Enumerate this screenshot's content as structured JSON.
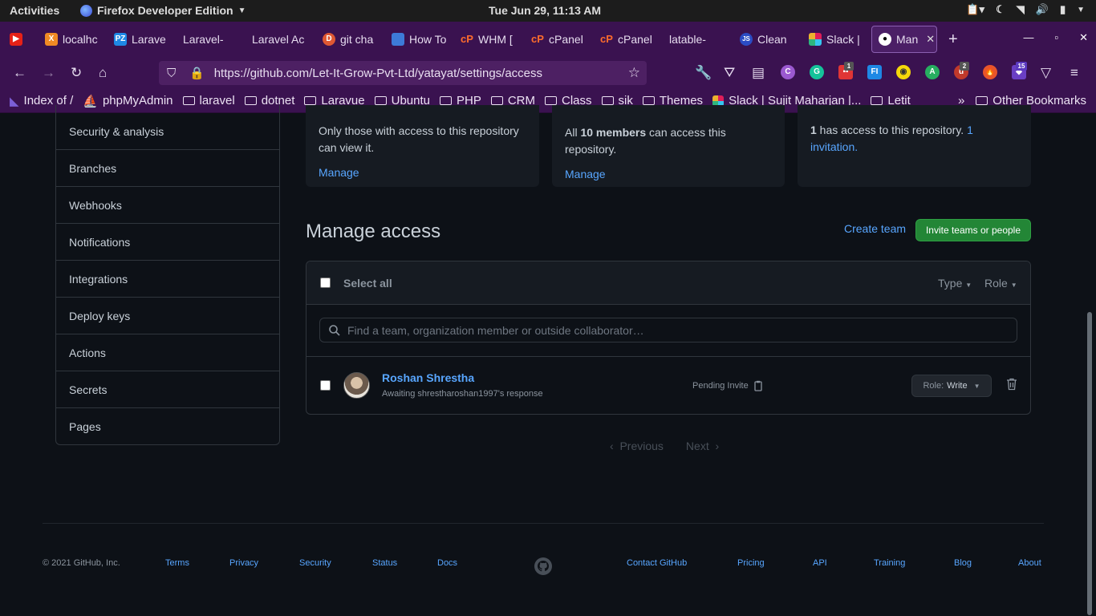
{
  "system_bar": {
    "activities": "Activities",
    "app_name": "Firefox Developer Edition",
    "datetime": "Tue Jun 29, 11:13 AM"
  },
  "tabs": [
    {
      "label": "localhc",
      "icon": "youtube-icon"
    },
    {
      "label": "Larave",
      "icon": "xampp-icon"
    },
    {
      "label": "Laravel-",
      "icon": "pz-icon"
    },
    {
      "label": "Laravel Ac",
      "icon": "blank-icon"
    },
    {
      "label": "git cha",
      "icon": "duckduckgo-icon"
    },
    {
      "label": "How To",
      "icon": "blank-icon"
    },
    {
      "label": "WHM [",
      "icon": "cpanel-icon"
    },
    {
      "label": "cPanel",
      "icon": "cpanel-icon"
    },
    {
      "label": "cPanel",
      "icon": "cpanel-icon"
    },
    {
      "label": "latable-",
      "icon": "blank-icon"
    },
    {
      "label": "Clean",
      "icon": "js-icon"
    },
    {
      "label": "Slack |",
      "icon": "slack-icon"
    },
    {
      "label": "Man",
      "icon": "github-icon"
    }
  ],
  "url": "https://github.com/Let-It-Grow-Pvt-Ltd/yatayat/settings/access",
  "extension_badges": [
    "1",
    "2",
    "15"
  ],
  "bookmarks": [
    {
      "label": "Index of /",
      "type": "page"
    },
    {
      "label": "phpMyAdmin",
      "type": "page"
    },
    {
      "label": "laravel",
      "type": "folder"
    },
    {
      "label": "dotnet",
      "type": "folder"
    },
    {
      "label": "Laravue",
      "type": "folder"
    },
    {
      "label": "Ubuntu",
      "type": "folder"
    },
    {
      "label": "PHP",
      "type": "folder"
    },
    {
      "label": "CRM",
      "type": "folder"
    },
    {
      "label": "Class",
      "type": "folder"
    },
    {
      "label": "sik",
      "type": "folder"
    },
    {
      "label": "Themes",
      "type": "folder"
    },
    {
      "label": "Slack | Sujit Maharjan |...",
      "type": "page"
    },
    {
      "label": "Letit",
      "type": "folder"
    }
  ],
  "other_bookmarks": "Other Bookmarks",
  "sidebar": {
    "items": [
      "Security & analysis",
      "Branches",
      "Webhooks",
      "Notifications",
      "Integrations",
      "Deploy keys",
      "Actions",
      "Secrets",
      "Pages"
    ]
  },
  "cards": {
    "visibility": {
      "text": "Only those with access to this repository can view it.",
      "link": "Manage"
    },
    "base": {
      "prefix": "All ",
      "bold": "10 members",
      "suffix": " can access this repository.",
      "link": "Manage"
    },
    "direct": {
      "count": "1",
      "text": " has access to this repository. ",
      "link": "1 invitation",
      "end": "."
    }
  },
  "manage_access": {
    "title": "Manage access",
    "create_team": "Create team",
    "invite_button": "Invite teams or people",
    "select_all": "Select all",
    "filter_type": "Type",
    "filter_role": "Role",
    "search_placeholder": "Find a team, organization member or outside collaborator…",
    "members": [
      {
        "name": "Roshan Shrestha",
        "subtitle": "Awaiting shrestharoshan1997's response",
        "status": "Pending Invite",
        "role_label": "Role:",
        "role_value": "Write"
      }
    ],
    "pagination": {
      "previous": "Previous",
      "next": "Next"
    }
  },
  "footer": {
    "copyright": "© 2021 GitHub, Inc.",
    "left_links": [
      "Terms",
      "Privacy",
      "Security",
      "Status",
      "Docs"
    ],
    "right_links": [
      "Contact GitHub",
      "Pricing",
      "API",
      "Training",
      "Blog",
      "About"
    ]
  },
  "colors": {
    "page_bg": "#0d1117",
    "link": "#58a6ff",
    "primary_button": "#238636",
    "browser_chrome": "#3a1250"
  }
}
